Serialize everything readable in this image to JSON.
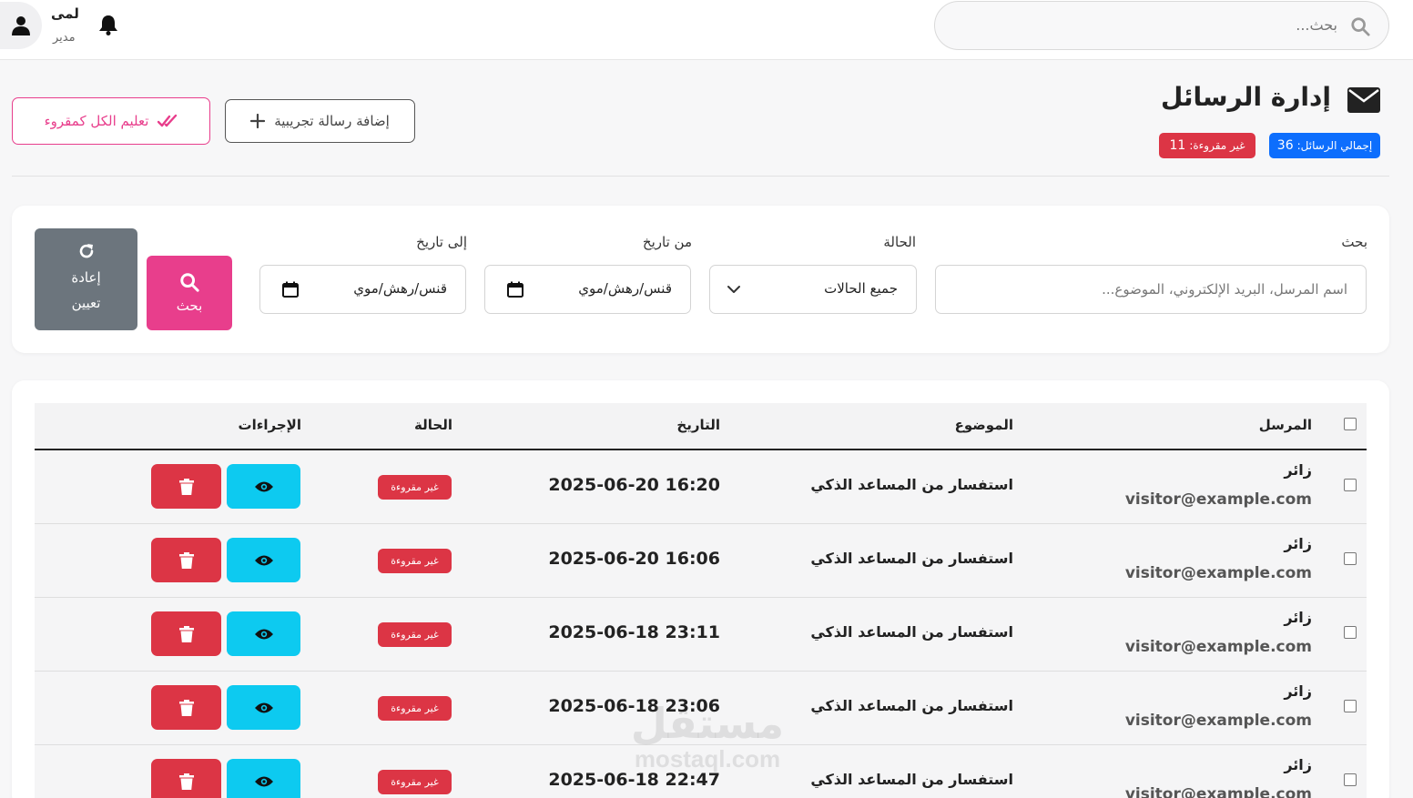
{
  "topbar": {
    "search_placeholder": "بحث...",
    "user_name": "لمى",
    "user_role": "مدير"
  },
  "header": {
    "title": "إدارة الرسائل",
    "total_label": "إجمالي الرسائل:",
    "total_value": "36",
    "unread_label": "غير مقروءة:",
    "unread_value": "11",
    "add_test_label": "إضافة رسالة تجريبية",
    "mark_all_label": "تعليم الكل كمقروء"
  },
  "filters": {
    "search_label": "بحث",
    "search_placeholder": "اسم المرسل، البريد الإلكتروني، الموضوع...",
    "status_label": "الحالة",
    "status_value": "جميع الحالات",
    "from_label": "من تاريخ",
    "from_value": "ﻗﻨﺲ/رهش/موي",
    "to_label": "إلى تاريخ",
    "to_value": "ﻗﻨﺲ/رهش/موي",
    "search_button": "بحث",
    "reset_button_line1": "إعادة",
    "reset_button_line2": "تعيين"
  },
  "table": {
    "columns": {
      "sender": "المرسل",
      "subject": "الموضوع",
      "date": "التاريخ",
      "status": "الحالة",
      "actions": "الإجراءات"
    },
    "rows": [
      {
        "sender": "زائر",
        "email": "visitor@example.com",
        "subject": "استفسار من المساعد الذكي",
        "date": "2025-06-20 16:20",
        "status": "غير مقروءة"
      },
      {
        "sender": "زائر",
        "email": "visitor@example.com",
        "subject": "استفسار من المساعد الذكي",
        "date": "2025-06-20 16:06",
        "status": "غير مقروءة"
      },
      {
        "sender": "زائر",
        "email": "visitor@example.com",
        "subject": "استفسار من المساعد الذكي",
        "date": "2025-06-18 23:11",
        "status": "غير مقروءة"
      },
      {
        "sender": "زائر",
        "email": "visitor@example.com",
        "subject": "استفسار من المساعد الذكي",
        "date": "2025-06-18 23:06",
        "status": "غير مقروءة"
      },
      {
        "sender": "زائر",
        "email": "visitor@example.com",
        "subject": "استفسار من المساعد الذكي",
        "date": "2025-06-18 22:47",
        "status": "غير مقروءة"
      }
    ]
  },
  "watermark": {
    "line1": "مستقل",
    "line2": "mostaql.com"
  },
  "colors": {
    "primary_blue": "#0d6efd",
    "danger_red": "#dc3545",
    "pink": "#e83e8c",
    "info_cyan": "#0dcaf0",
    "secondary_gray": "#6c757d"
  },
  "icons": [
    "search-icon",
    "user-icon",
    "bell-icon",
    "envelope-icon",
    "plus-icon",
    "double-check-icon",
    "calendar-icon",
    "chevron-down-icon",
    "refresh-icon",
    "eye-icon",
    "trash-icon"
  ]
}
